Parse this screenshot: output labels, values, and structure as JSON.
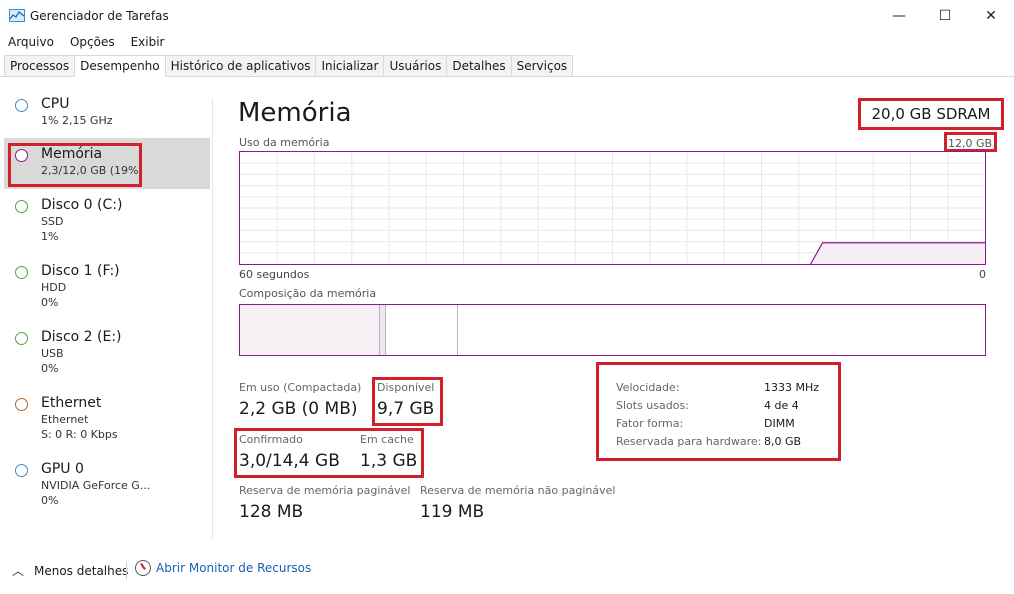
{
  "window": {
    "title": "Gerenciador de Tarefas",
    "controls": {
      "minimize": "—",
      "maximize": "☐",
      "close": "✕"
    }
  },
  "menu": [
    "Arquivo",
    "Opções",
    "Exibir"
  ],
  "tabs": [
    {
      "label": "Processos",
      "active": false
    },
    {
      "label": "Desempenho",
      "active": true
    },
    {
      "label": "Histórico de aplicativos",
      "active": false
    },
    {
      "label": "Inicializar",
      "active": false
    },
    {
      "label": "Usuários",
      "active": false
    },
    {
      "label": "Detalhes",
      "active": false
    },
    {
      "label": "Serviços",
      "active": false
    }
  ],
  "sidebar": {
    "items": [
      {
        "name": "CPU",
        "sub1": "1% 2,15 GHz",
        "sub2": "",
        "color": "#3d8fd7"
      },
      {
        "name": "Memória",
        "sub1": "2,3/12,0 GB (19%)",
        "sub2": "",
        "color": "#8b1b8b"
      },
      {
        "name": "Disco 0 (C:)",
        "sub1": "SSD",
        "sub2": "1%",
        "color": "#4fa83d"
      },
      {
        "name": "Disco 1 (F:)",
        "sub1": "HDD",
        "sub2": "0%",
        "color": "#4fa83d"
      },
      {
        "name": "Disco 2 (E:)",
        "sub1": "USB",
        "sub2": "0%",
        "color": "#4fa83d"
      },
      {
        "name": "Ethernet",
        "sub1": "Ethernet",
        "sub2": "S: 0 R: 0 Kbps",
        "color": "#b5651d"
      },
      {
        "name": "GPU 0",
        "sub1": "NVIDIA GeForce G...",
        "sub2": "0%",
        "color": "#3d8fd7"
      }
    ]
  },
  "main": {
    "title": "Memória",
    "total": "20,0 GB SDRAM",
    "graph_label": "Uso da memória",
    "graph_max": "12,0 GB",
    "axis_left": "60 segundos",
    "axis_right": "0",
    "composition_label": "Composição da memória",
    "usage_fraction": 0.19
  },
  "stats": {
    "in_use": {
      "label": "Em uso (Compactada)",
      "value": "2,2 GB (0 MB)"
    },
    "available": {
      "label": "Disponível",
      "value": "9,7 GB"
    },
    "committed": {
      "label": "Confirmado",
      "value": "3,0/14,4 GB"
    },
    "cached": {
      "label": "Em cache",
      "value": "1,3 GB"
    },
    "paged": {
      "label": "Reserva de memória paginável",
      "value": "128 MB"
    },
    "nonpaged": {
      "label": "Reserva de memória não paginável",
      "value": "119 MB"
    }
  },
  "properties": [
    {
      "key": "Velocidade:",
      "value": "1333 MHz"
    },
    {
      "key": "Slots usados:",
      "value": "4 de 4"
    },
    {
      "key": "Fator forma:",
      "value": "DIMM"
    },
    {
      "key": "Reservada para hardware:",
      "value": "8,0 GB"
    }
  ],
  "footer": {
    "fewer_details": "Menos detalhes",
    "resource_monitor": "Abrir Monitor de Recursos"
  },
  "colors": {
    "memory_accent": "#8b1b8b",
    "highlight_box": "#d21f2c",
    "link": "#1a5fb4"
  }
}
